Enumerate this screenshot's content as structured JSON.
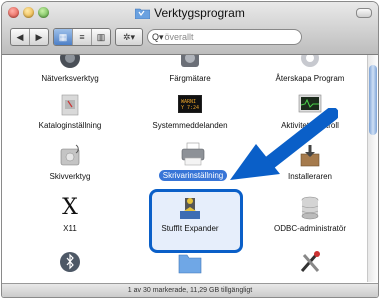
{
  "window": {
    "title": "Verktygsprogram",
    "status": "1 av 30 markerade, 11,29 GB tillgängligt"
  },
  "toolbar": {
    "back_glyph": "◀",
    "forward_glyph": "▶",
    "view_icon_glyph": "▦",
    "view_list_glyph": "≡",
    "view_column_glyph": "▥",
    "action_glyph": "✲▾",
    "search_icon_glyph": "Q▾",
    "search_placeholder": "överallt"
  },
  "items": [
    {
      "label": "Nätverksverktyg",
      "icon": "network-utility-icon"
    },
    {
      "label": "Färgmätare",
      "icon": "digitalcolor-meter-icon"
    },
    {
      "label": "Återskapa Program",
      "icon": "migration-assistant-icon"
    },
    {
      "label": "Kataloginställning",
      "icon": "directory-utility-icon"
    },
    {
      "label": "Systemmeddelanden",
      "icon": "console-icon"
    },
    {
      "label": "Aktivitetskontroll",
      "icon": "activity-monitor-icon"
    },
    {
      "label": "Skivverktyg",
      "icon": "disk-utility-icon"
    },
    {
      "label": "Skrivarinställning",
      "icon": "printer-setup-icon",
      "selected": true
    },
    {
      "label": "Installeraren",
      "icon": "installer-icon"
    },
    {
      "label": "X11",
      "icon": "x11-icon",
      "glyph": "X"
    },
    {
      "label": "StuffIt Expander",
      "icon": "stuffit-expander-icon"
    },
    {
      "label": "ODBC-administratör",
      "icon": "odbc-administrator-icon"
    },
    {
      "label": "",
      "icon": "bluetooth-icon"
    },
    {
      "label": "",
      "icon": "folder-icon"
    },
    {
      "label": "",
      "icon": "tools-icon"
    }
  ],
  "colors": {
    "highlight": "#0a5fc8",
    "selection": "#3875d7"
  }
}
